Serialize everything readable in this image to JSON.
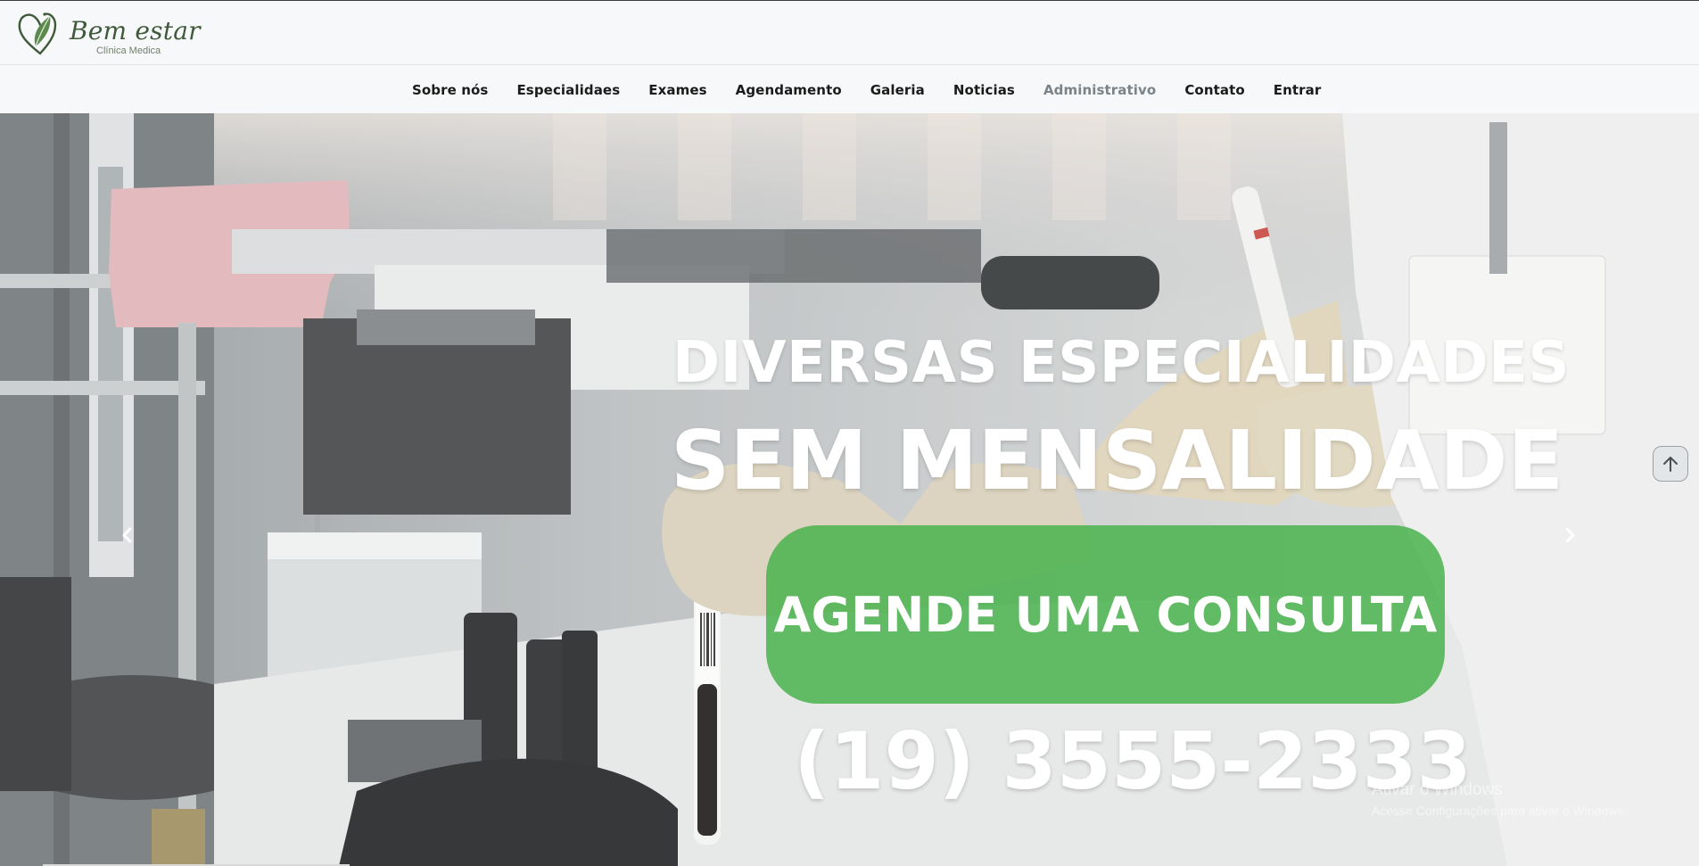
{
  "brand": {
    "name": "Bem estar",
    "tagline": "Clínica Medica",
    "color": "#3f5a3a"
  },
  "nav": {
    "items": [
      {
        "label": "Sobre nós"
      },
      {
        "label": "Especialidaes"
      },
      {
        "label": "Exames"
      },
      {
        "label": "Agendamento"
      },
      {
        "label": "Galeria"
      },
      {
        "label": "Noticias"
      },
      {
        "label": "Administrativo"
      },
      {
        "label": "Contato"
      },
      {
        "label": "Entrar"
      }
    ],
    "muted_item": "Administrativo"
  },
  "hero": {
    "headline_1": "DIVERSAS ESPECIALIDADES",
    "headline_2": "SEM MENSALIDADE",
    "cta_label": "AGENDE UMA CONSULTA",
    "phone": "(19) 3555-2333",
    "cta_color": "#4ab24e",
    "icons": {
      "prev": "chevron-left-icon",
      "next": "chevron-right-icon",
      "scroll_top": "arrow-up-icon"
    }
  },
  "windows_watermark": {
    "title": "Ativar o Windows",
    "subtitle": "Acesse Configurações para ativar o Windows."
  }
}
